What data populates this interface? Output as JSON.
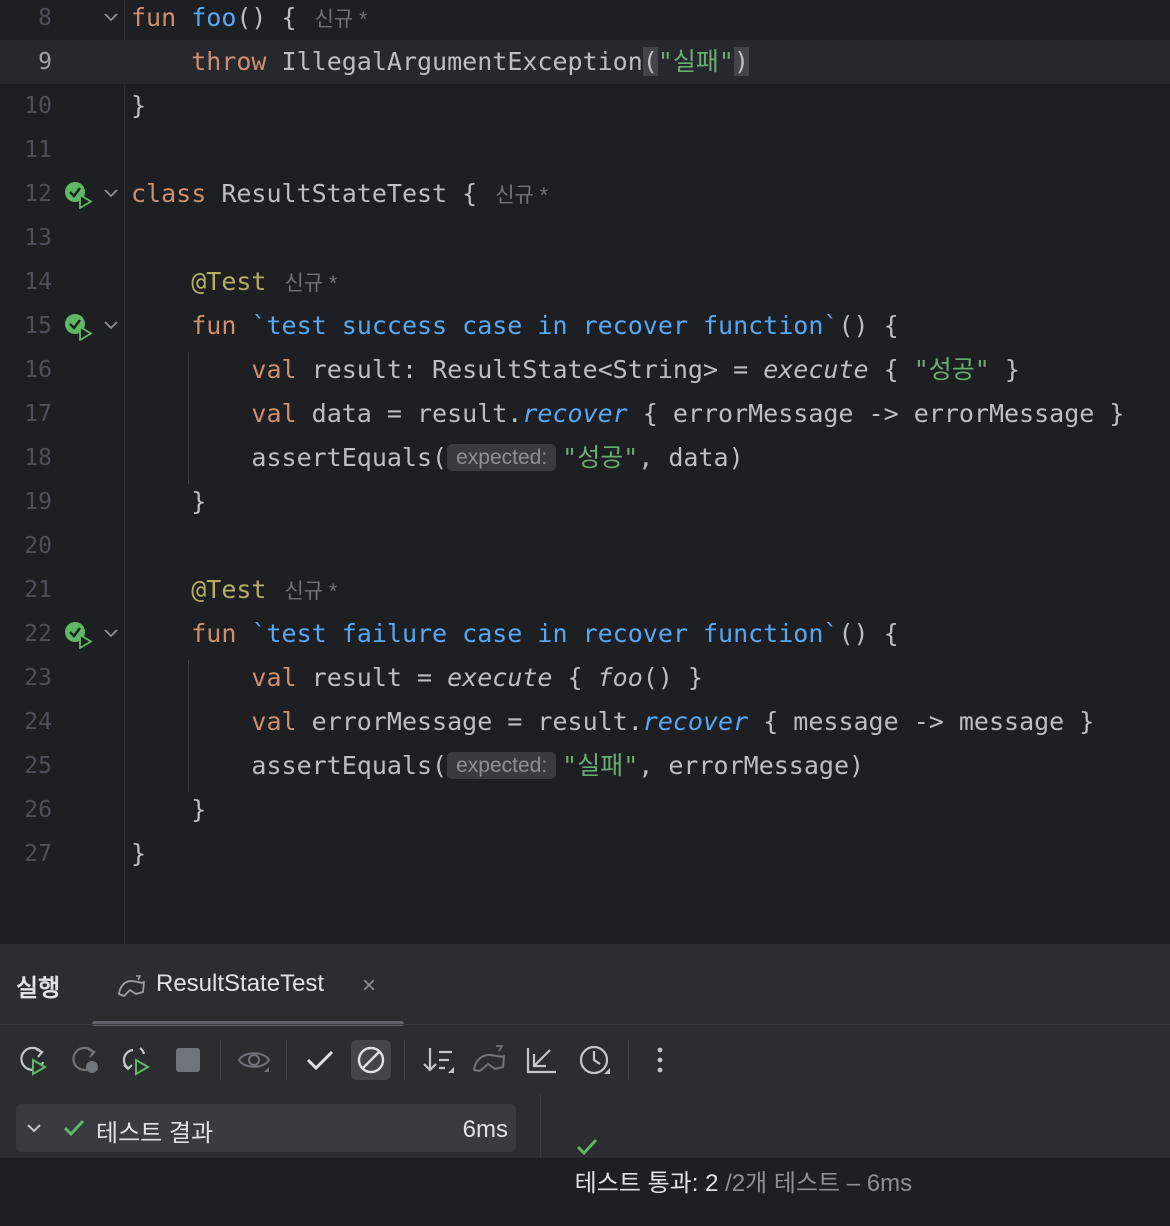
{
  "editor": {
    "code_hint": "신규 *",
    "lines": [
      {
        "num": "8"
      },
      {
        "num": "9"
      },
      {
        "num": "10"
      },
      {
        "num": "11"
      },
      {
        "num": "12"
      },
      {
        "num": "13"
      },
      {
        "num": "14"
      },
      {
        "num": "15"
      },
      {
        "num": "16"
      },
      {
        "num": "17"
      },
      {
        "num": "18"
      },
      {
        "num": "19"
      },
      {
        "num": "20"
      },
      {
        "num": "21"
      },
      {
        "num": "22"
      },
      {
        "num": "23"
      },
      {
        "num": "24"
      },
      {
        "num": "25"
      },
      {
        "num": "26"
      },
      {
        "num": "27"
      }
    ],
    "tokens": {
      "fun": "fun",
      "foo": "foo",
      "paren_open_brace": "() {",
      "throw": "throw",
      "exception": "IllegalArgumentException",
      "open_paren": "(",
      "close_paren": ")",
      "fail_str": "\"실패\"",
      "success_str": "\"성공\"",
      "close_brace": "}",
      "class": "class",
      "class_name": "ResultStateTest",
      "open_brace": "{",
      "annotation": "@Test",
      "test1_name": "`test success case in recover function`",
      "test2_name": "`test failure case in recover function`",
      "val": "val",
      "result_decl_typed": "result: ResultState<String> = ",
      "execute": "execute",
      "data_assign": "data = result.",
      "recover": "recover",
      "lambda_error": " { errorMessage -> errorMessage }",
      "assert": "assertEquals(",
      "expected_hint": "expected:",
      "data_close": ", data)",
      "result_decl": "result = ",
      "foo_call": "foo",
      "foo_call_rest": "() }",
      "lambda_open": " { ",
      "lambda_close": " }",
      "errmsg_assign": "errorMessage = result.",
      "lambda_message": " { message -> message }",
      "errmsg_close": ", errorMessage)"
    }
  },
  "run_panel": {
    "title": "실행",
    "tab_label": "ResultStateTest",
    "tab_close": "×",
    "results_label": "테스트 결과",
    "results_time": "6ms",
    "status_main": "테스트 통과: 2",
    "status_sub": " /2개 테스트 – 6ms",
    "toolbar_icons": [
      "rerun-icon",
      "rerun-failed-icon",
      "toggle-auto-test-icon",
      "stop-icon",
      "show-passed-eye-icon",
      "show-passed-check-icon",
      "show-ignored-icon",
      "sort-icon",
      "import-tests-icon",
      "collapse-all-icon",
      "history-icon",
      "more-options-icon"
    ]
  },
  "colors": {
    "background": "#1e1f22",
    "keyword": "#cf8e6d",
    "function": "#56a8f5",
    "string": "#6aab73",
    "annotation": "#b3ae60",
    "text": "#bcbec4",
    "success": "#5fb865"
  }
}
